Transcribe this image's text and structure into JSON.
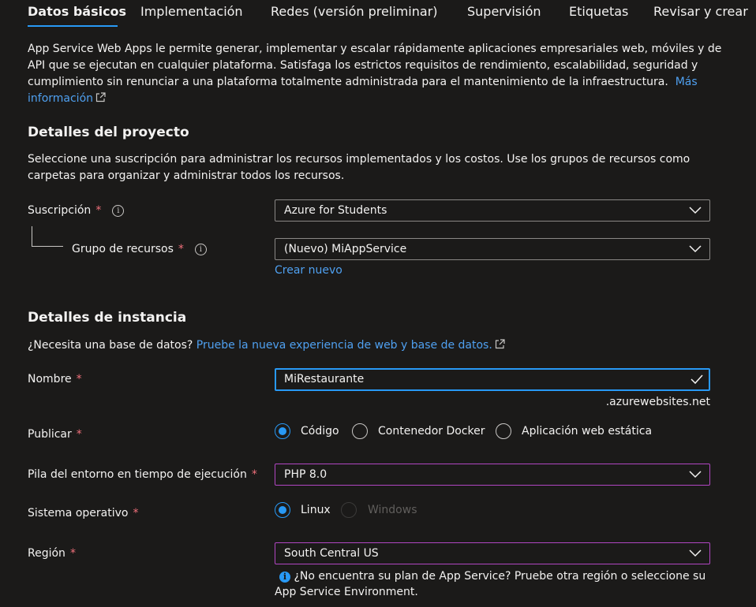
{
  "tabs": [
    {
      "label": "Datos básicos",
      "active": true
    },
    {
      "label": "Implementación"
    },
    {
      "label": "Redes (versión preliminar)"
    },
    {
      "label": "Supervisión"
    },
    {
      "label": "Etiquetas"
    },
    {
      "label": "Revisar y crear"
    }
  ],
  "intro": {
    "line1": "App Service Web Apps le permite generar, implementar y escalar rápidamente aplicaciones empresariales web, móviles y de",
    "line2": "API que se ejecutan en cualquier plataforma. Satisfaga los estrictos requisitos de rendimiento, escalabilidad, seguridad y",
    "line3": "cumplimiento sin renunciar a una plataforma totalmente administrada para el mantenimiento de la infraestructura.",
    "link_part1": "Más",
    "link_part2": "información"
  },
  "project": {
    "heading": "Detalles del proyecto",
    "desc_line1": "Seleccione una suscripción para administrar los recursos implementados y los costos. Use los grupos de recursos como",
    "desc_line2": "carpetas para organizar y administrar todos los recursos.",
    "subscription_label": "Suscripción",
    "subscription_value": "Azure for Students",
    "resource_group_label": "Grupo de recursos",
    "resource_group_value": "(Nuevo) MiAppService",
    "create_new": "Crear nuevo"
  },
  "instance": {
    "heading": "Detalles de instancia",
    "db_question": "¿Necesita una base de datos?",
    "db_link": "Pruebe la nueva experiencia de web y base de datos.",
    "name_label": "Nombre",
    "name_value": "MiRestaurante",
    "name_suffix": ".azurewebsites.net",
    "publish_label": "Publicar",
    "publish_options": [
      "Código",
      "Contenedor Docker",
      "Aplicación web estática"
    ],
    "publish_selected": "Código",
    "runtime_label": "Pila del entorno en tiempo de ejecución",
    "runtime_value": "PHP 8.0",
    "os_label": "Sistema operativo",
    "os_options": [
      "Linux",
      "Windows"
    ],
    "os_selected": "Linux",
    "region_label": "Región",
    "region_value": "South Central US",
    "region_hint_line1": "¿No encuentra su plan de App Service? Pruebe otra región o seleccione su",
    "region_hint_line2": "App Service Environment."
  },
  "required_marker": "*",
  "colors": {
    "accent": "#2899f5",
    "link": "#4fa0f0",
    "required": "#f1707b",
    "focus_purple": "#b146c2"
  }
}
